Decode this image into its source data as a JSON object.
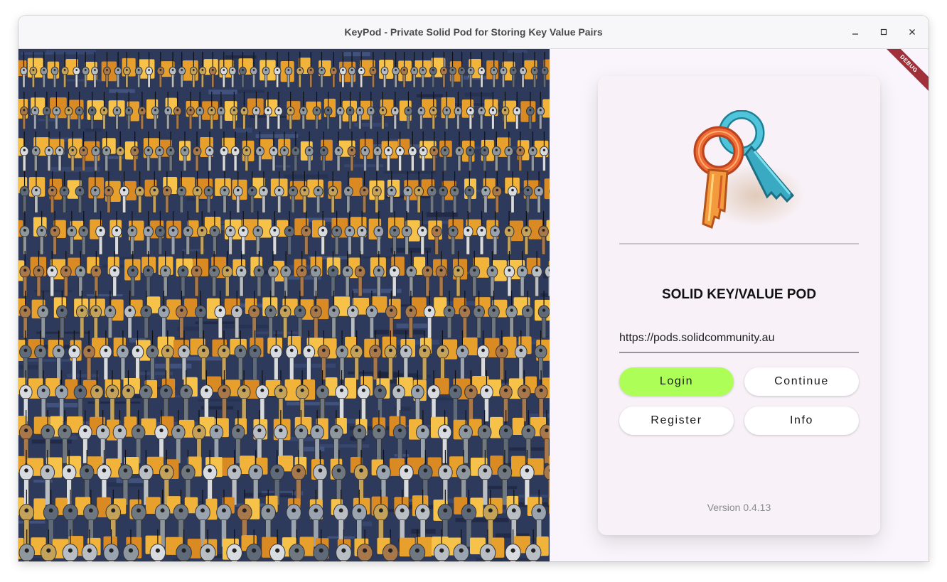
{
  "window": {
    "title": "KeyPod - Private Solid Pod for Storing Key Value Pairs",
    "minimize_icon": "minimize-icon",
    "maximize_icon": "maximize-icon",
    "close_icon": "close-icon"
  },
  "banner": {
    "debug": "DEBUG"
  },
  "login_card": {
    "title": "SOLID KEY/VALUE POD",
    "server_url": "https://pods.solidcommunity.au",
    "login_label": "Login",
    "continue_label": "Continue",
    "register_label": "Register",
    "info_label": "Info",
    "version": "Version 0.4.13"
  },
  "colors": {
    "login_button": "#adff58",
    "debug_ribbon": "#a0303a",
    "panel_background": "#faf5fc"
  },
  "icons": {
    "logo": "keys-logo-icon",
    "hero_image": "wall-of-keys-image"
  }
}
